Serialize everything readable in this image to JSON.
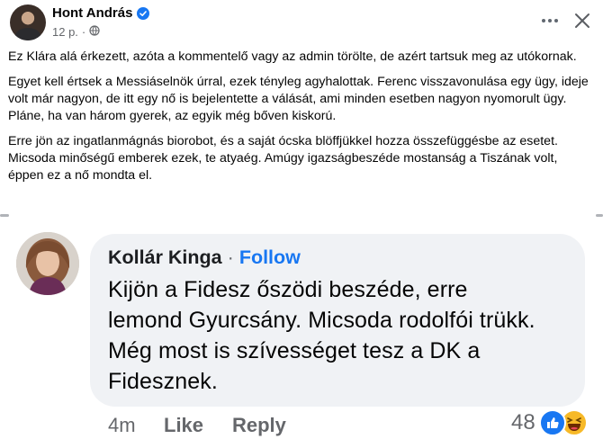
{
  "post": {
    "author": "Hont András",
    "time": "12 p.",
    "visibility_icon": "globe-icon",
    "paragraphs": [
      "Ez Klára alá érkezett, azóta a kommentelő vagy az admin törölte, de azért tartsuk meg az utókornak.",
      "Egyet kell értsek a Messiáselnök úrral, ezek tényleg agyhalottak. Ferenc visszavonulása egy ügy, ideje volt már nagyon, de itt egy nő is bejelentette a válását, ami minden esetben nagyon nyomorult ügy. Pláne, ha van három gyerek, az egyik még bőven kiskorú.",
      "Erre jön az ingatlanmágnás biorobot, és a saját ócska blöffjükkel hozza összefüggésbe az esetet. Micsoda minőségű emberek ezek, te atyaég. Amúgy igazságbeszéde mostanság a Tiszának volt, éppen ez a nő mondta el."
    ]
  },
  "comment": {
    "author": "Kollár Kinga",
    "separator": "·",
    "follow_label": "Follow",
    "text_lines": [
      "Kijön a Fidesz őszödi beszéde, erre",
      "lemond Gyurcsány. Micsoda rodolfói trükk.",
      "Még most is szívességet tesz a DK a",
      "Fidesznek."
    ],
    "time": "4m",
    "like_label": "Like",
    "reply_label": "Reply",
    "reaction_count": "48",
    "reactions": [
      "like-icon",
      "haha-icon"
    ]
  },
  "colors": {
    "brand_blue": "#1877f2",
    "secondary_text": "#65676b",
    "bubble_bg": "#f0f2f5"
  }
}
